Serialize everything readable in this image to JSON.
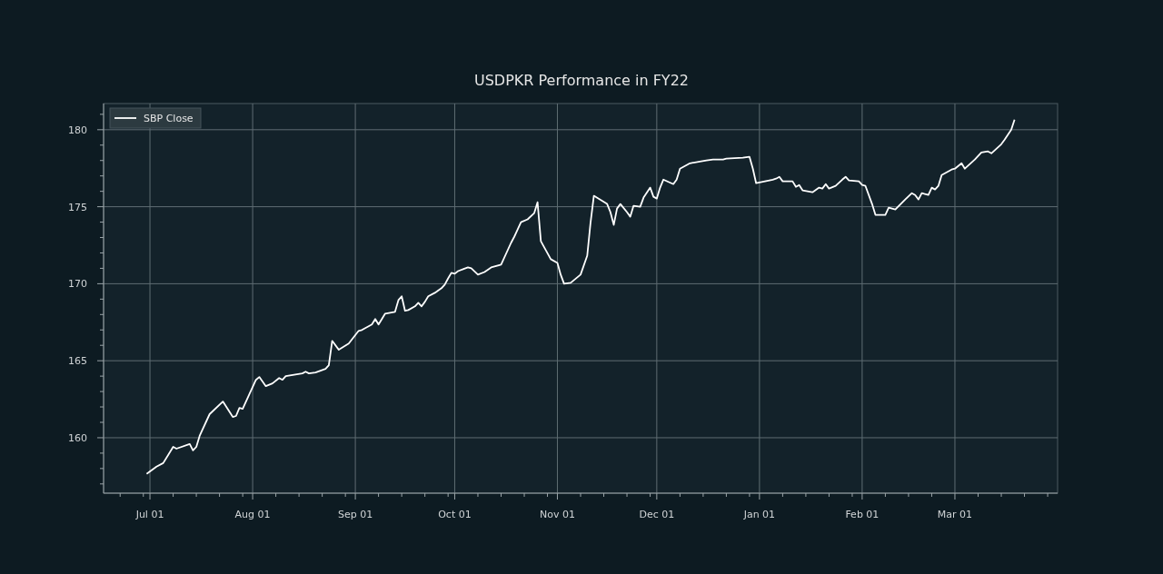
{
  "chart": {
    "chart_data": {
      "type": "line",
      "title": "USDPKR Performance in FY22",
      "grid": true,
      "xlim": [
        "2021-06-17",
        "2022-04-01"
      ],
      "ylim": [
        156.4,
        181.7
      ],
      "xticks": [
        {
          "value": "2021-07-01",
          "label": "Jul 01"
        },
        {
          "value": "2021-08-01",
          "label": "Aug 01"
        },
        {
          "value": "2021-09-01",
          "label": "Sep 01"
        },
        {
          "value": "2021-10-01",
          "label": "Oct 01"
        },
        {
          "value": "2021-11-01",
          "label": "Nov 01"
        },
        {
          "value": "2021-12-01",
          "label": "Dec 01"
        },
        {
          "value": "2022-01-01",
          "label": "Jan 01"
        },
        {
          "value": "2022-02-01",
          "label": "Feb 01"
        },
        {
          "value": "2022-03-01",
          "label": "Mar 01"
        }
      ],
      "yticks": [
        160,
        165,
        170,
        175,
        180
      ],
      "x": [
        "2021-06-30",
        "2021-07-03",
        "2021-07-05",
        "2021-07-08",
        "2021-07-09",
        "2021-07-13",
        "2021-07-14",
        "2021-07-15",
        "2021-07-16",
        "2021-07-19",
        "2021-07-23",
        "2021-07-26",
        "2021-07-27",
        "2021-07-28",
        "2021-07-29",
        "2021-08-02",
        "2021-08-03",
        "2021-08-05",
        "2021-08-07",
        "2021-08-09",
        "2021-08-10",
        "2021-08-11",
        "2021-08-16",
        "2021-08-17",
        "2021-08-18",
        "2021-08-20",
        "2021-08-23",
        "2021-08-24",
        "2021-08-25",
        "2021-08-27",
        "2021-08-30",
        "2021-09-02",
        "2021-09-03",
        "2021-09-04",
        "2021-09-06",
        "2021-09-07",
        "2021-09-08",
        "2021-09-09",
        "2021-09-10",
        "2021-09-13",
        "2021-09-14",
        "2021-09-15",
        "2021-09-16",
        "2021-09-17",
        "2021-09-19",
        "2021-09-20",
        "2021-09-21",
        "2021-09-22",
        "2021-09-23",
        "2021-09-25",
        "2021-09-27",
        "2021-09-28",
        "2021-09-29",
        "2021-09-30",
        "2021-10-01",
        "2021-10-02",
        "2021-10-05",
        "2021-10-06",
        "2021-10-08",
        "2021-10-10",
        "2021-10-12",
        "2021-10-14",
        "2021-10-15",
        "2021-10-18",
        "2021-10-19",
        "2021-10-21",
        "2021-10-23",
        "2021-10-25",
        "2021-10-26",
        "2021-10-27",
        "2021-10-30",
        "2021-11-01",
        "2021-11-02",
        "2021-11-03",
        "2021-11-05",
        "2021-11-08",
        "2021-11-10",
        "2021-11-11",
        "2021-11-12",
        "2021-11-16",
        "2021-11-17",
        "2021-11-18",
        "2021-11-19",
        "2021-11-20",
        "2021-11-22",
        "2021-11-23",
        "2021-11-24",
        "2021-11-26",
        "2021-11-27",
        "2021-11-29",
        "2021-11-30",
        "2021-12-01",
        "2021-12-02",
        "2021-12-03",
        "2021-12-06",
        "2021-12-07",
        "2021-12-08",
        "2021-12-10",
        "2021-12-11",
        "2021-12-14",
        "2021-12-16",
        "2021-12-18",
        "2021-12-21",
        "2021-12-22",
        "2021-12-27",
        "2021-12-29",
        "2021-12-30",
        "2021-12-31",
        "2022-01-05",
        "2022-01-06",
        "2022-01-07",
        "2022-01-08",
        "2022-01-11",
        "2022-01-12",
        "2022-01-13",
        "2022-01-14",
        "2022-01-17",
        "2022-01-19",
        "2022-01-20",
        "2022-01-21",
        "2022-01-22",
        "2022-01-24",
        "2022-01-26",
        "2022-01-27",
        "2022-01-28",
        "2022-01-31",
        "2022-02-01",
        "2022-02-02",
        "2022-02-04",
        "2022-02-05",
        "2022-02-08",
        "2022-02-09",
        "2022-02-11",
        "2022-02-14",
        "2022-02-16",
        "2022-02-17",
        "2022-02-18",
        "2022-02-19",
        "2022-02-21",
        "2022-02-22",
        "2022-02-23",
        "2022-02-24",
        "2022-02-25",
        "2022-02-28",
        "2022-03-01",
        "2022-03-03",
        "2022-03-04",
        "2022-03-07",
        "2022-03-09",
        "2022-03-11",
        "2022-03-12",
        "2022-03-15",
        "2022-03-16",
        "2022-03-18",
        "2022-03-19"
      ],
      "series": [
        {
          "name": "SBP Close",
          "color": "#ffffff",
          "values": [
            157.65,
            158.12,
            158.35,
            159.41,
            159.29,
            159.59,
            159.18,
            159.41,
            160.12,
            161.53,
            162.35,
            161.35,
            161.41,
            161.94,
            161.88,
            163.76,
            163.94,
            163.35,
            163.53,
            163.88,
            163.76,
            164.0,
            164.18,
            164.29,
            164.18,
            164.24,
            164.47,
            164.71,
            166.29,
            165.71,
            166.12,
            166.94,
            167.0,
            167.12,
            167.35,
            167.71,
            167.35,
            167.71,
            168.06,
            168.18,
            168.94,
            169.18,
            168.24,
            168.29,
            168.53,
            168.76,
            168.53,
            168.82,
            169.18,
            169.41,
            169.71,
            169.94,
            170.35,
            170.71,
            170.65,
            170.82,
            171.06,
            171.0,
            170.59,
            170.76,
            171.06,
            171.18,
            171.24,
            172.65,
            173.06,
            174.0,
            174.18,
            174.59,
            175.29,
            172.76,
            171.59,
            171.35,
            170.59,
            170.0,
            170.06,
            170.59,
            171.82,
            173.94,
            175.71,
            175.18,
            174.65,
            173.82,
            174.88,
            175.18,
            174.65,
            174.35,
            175.06,
            175.0,
            175.59,
            176.24,
            175.65,
            175.53,
            176.24,
            176.76,
            176.47,
            176.76,
            177.47,
            177.71,
            177.82,
            177.94,
            178.0,
            178.06,
            178.06,
            178.12,
            178.18,
            178.24,
            177.47,
            176.53,
            176.76,
            176.82,
            176.94,
            176.65,
            176.65,
            176.29,
            176.41,
            176.06,
            175.94,
            176.24,
            176.18,
            176.47,
            176.18,
            176.35,
            176.76,
            176.94,
            176.71,
            176.65,
            176.41,
            176.35,
            175.18,
            174.47,
            174.47,
            174.94,
            174.82,
            175.47,
            175.88,
            175.76,
            175.47,
            175.88,
            175.76,
            176.24,
            176.12,
            176.35,
            177.06,
            177.41,
            177.47,
            177.82,
            177.47,
            178.06,
            178.53,
            178.59,
            178.47,
            179.06,
            179.35,
            180.0,
            180.65
          ]
        }
      ]
    }
  }
}
